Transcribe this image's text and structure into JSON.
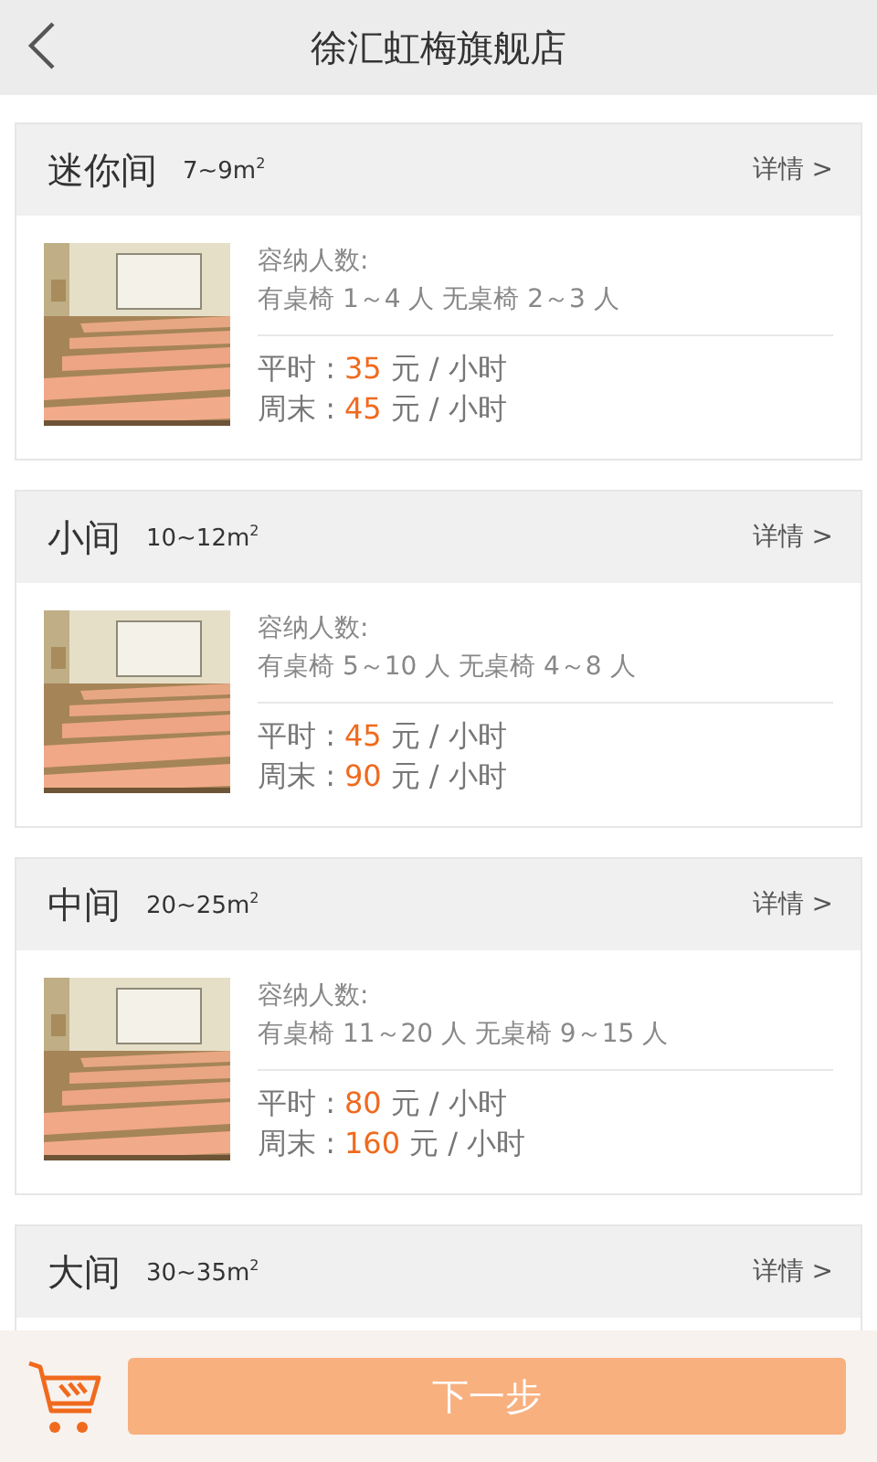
{
  "header": {
    "title": "徐汇虹梅旗舰店"
  },
  "rooms": [
    {
      "name": "迷你间",
      "area": "7~9m$^{2}$",
      "detail_link": "详情 >",
      "capacity_label": "容纳人数:",
      "capacity": "有桌椅 1～4 人  无桌椅 2～3 人",
      "prices": [
        {
          "label": "平时 :",
          "amount": "35",
          "unit": "元 / 小时"
        },
        {
          "label": "周末 :",
          "amount": "45",
          "unit": "元 / 小时"
        }
      ]
    },
    {
      "name": "小间",
      "area": "10~12m$^{2}$",
      "detail_link": "详情 >",
      "capacity_label": "容纳人数:",
      "capacity": "有桌椅 5～10 人  无桌椅 4～8 人",
      "prices": [
        {
          "label": "平时 :",
          "amount": "45",
          "unit": "元 / 小时"
        },
        {
          "label": "周末 :",
          "amount": "90",
          "unit": "元 / 小时"
        }
      ]
    },
    {
      "name": "中间",
      "area": "20~25m$^{2}$",
      "detail_link": "详情 >",
      "capacity_label": "容纳人数:",
      "capacity": "有桌椅 11～20 人  无桌椅 9～15 人",
      "prices": [
        {
          "label": "平时 :",
          "amount": "80",
          "unit": "元 / 小时"
        },
        {
          "label": "周末 :",
          "amount": "160",
          "unit": "元 / 小时"
        }
      ]
    },
    {
      "name": "大间",
      "area": "30~35m$^{2}$",
      "detail_link": "详情 >"
    }
  ],
  "bottom_bar": {
    "next_button": "下一步"
  }
}
